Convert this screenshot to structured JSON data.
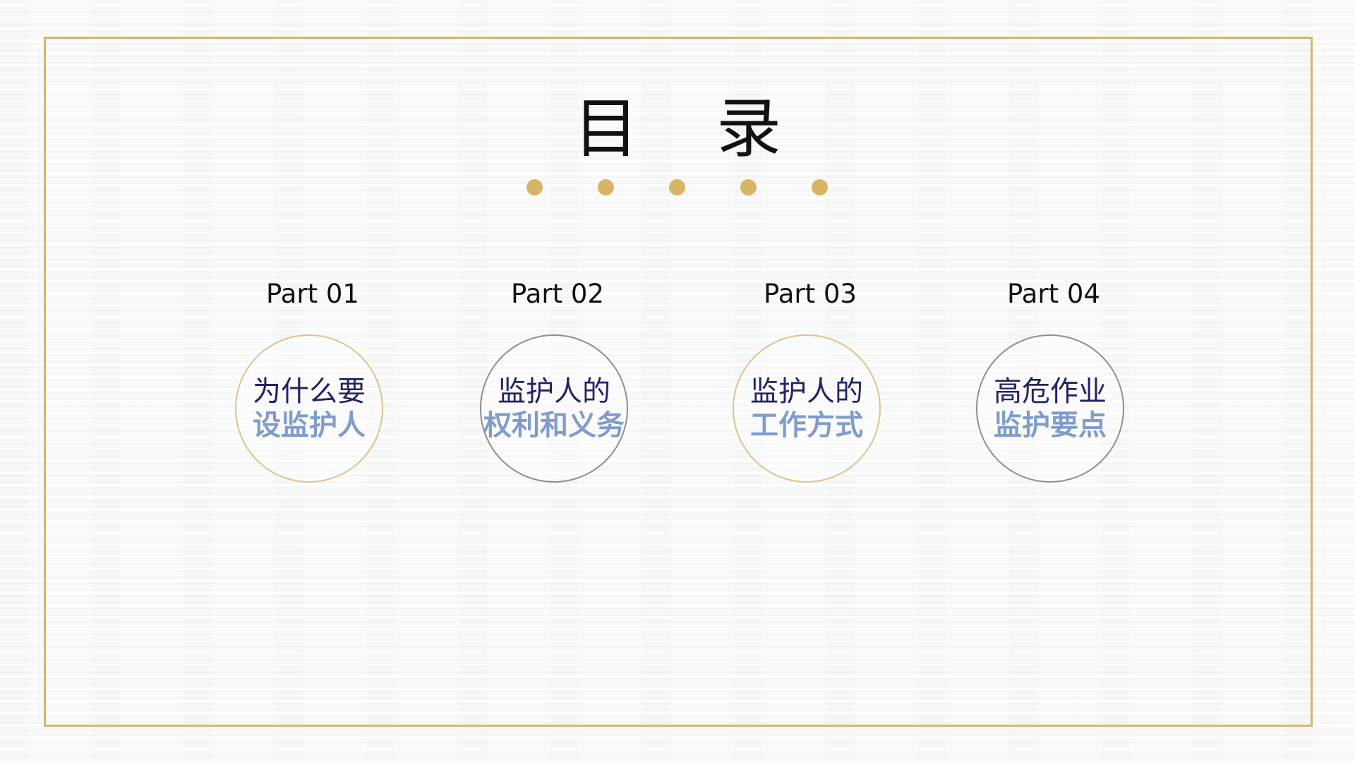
{
  "title": "目录",
  "title_chars": [
    "目",
    "录"
  ],
  "colors": {
    "accent_gold": "#d6b564",
    "circle_gold": "#dcc38a",
    "circle_gray": "#8e8e8e",
    "text_dark_navy": "#232361",
    "text_light_blue": "#7f9ccb",
    "title_text": "#111111"
  },
  "sections": [
    {
      "part": "Part 01",
      "line1": "为什么要",
      "line2": "设监护人",
      "ring": "gold"
    },
    {
      "part": "Part 02",
      "line1": "监护人的",
      "line2": "权利和义务",
      "ring": "gray"
    },
    {
      "part": "Part 03",
      "line1": "监护人的",
      "line2": "工作方式",
      "ring": "gold"
    },
    {
      "part": "Part 04",
      "line1": "高危作业",
      "line2": "监护要点",
      "ring": "gray"
    }
  ]
}
